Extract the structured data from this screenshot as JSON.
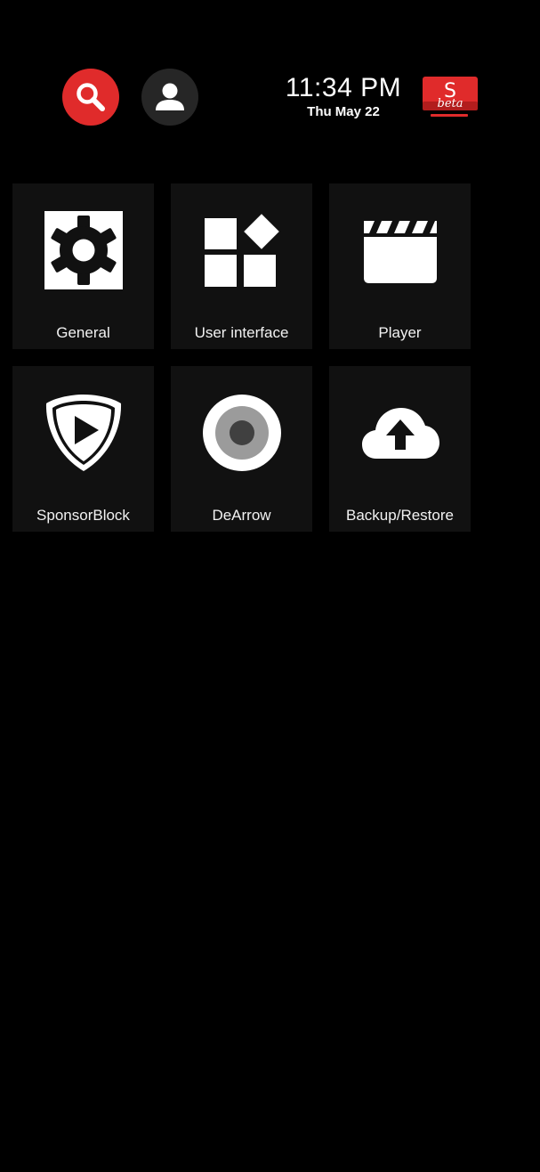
{
  "header": {
    "search_icon": "search-icon",
    "account_icon": "account-icon",
    "time": "11:34 PM",
    "date": "Thu May 22",
    "logo": {
      "letter": "S",
      "badge": "beta",
      "color": "#e02b2b"
    },
    "colors": {
      "search_button": "#e02b2b",
      "account_button": "#262626"
    }
  },
  "settings": {
    "tiles": [
      {
        "label": "General",
        "icon": "gear-icon"
      },
      {
        "label": "User interface",
        "icon": "widgets-icon"
      },
      {
        "label": "Player",
        "icon": "clapperboard-icon"
      },
      {
        "label": "SponsorBlock",
        "icon": "shield-play-icon"
      },
      {
        "label": "DeArrow",
        "icon": "dearrow-icon"
      },
      {
        "label": "Backup/Restore",
        "icon": "cloud-upload-icon"
      }
    ],
    "tile_background": "#111111"
  },
  "background": "#000000"
}
